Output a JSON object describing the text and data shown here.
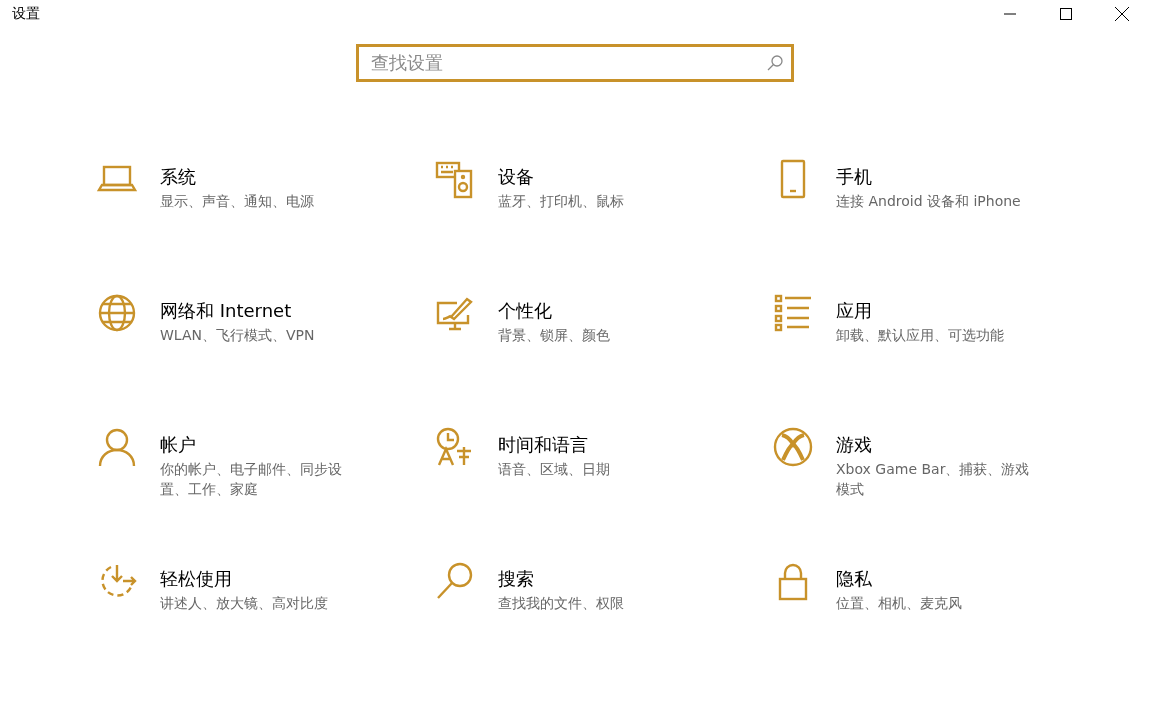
{
  "window": {
    "title": "设置"
  },
  "search": {
    "placeholder": "查找设置"
  },
  "categories": [
    {
      "kind": "system",
      "title": "系统",
      "description": "显示、声音、通知、电源"
    },
    {
      "kind": "devices",
      "title": "设备",
      "description": "蓝牙、打印机、鼠标"
    },
    {
      "kind": "phone",
      "title": "手机",
      "description": "连接 Android 设备和 iPhone"
    },
    {
      "kind": "network",
      "title": "网络和 Internet",
      "description": "WLAN、飞行模式、VPN"
    },
    {
      "kind": "personalization",
      "title": "个性化",
      "description": "背景、锁屏、颜色"
    },
    {
      "kind": "apps",
      "title": "应用",
      "description": "卸载、默认应用、可选功能"
    },
    {
      "kind": "accounts",
      "title": "帐户",
      "description": "你的帐户、电子邮件、同步设置、工作、家庭"
    },
    {
      "kind": "time",
      "title": "时间和语言",
      "description": "语音、区域、日期"
    },
    {
      "kind": "gaming",
      "title": "游戏",
      "description": "Xbox Game Bar、捕获、游戏模式"
    },
    {
      "kind": "ease",
      "title": "轻松使用",
      "description": "讲述人、放大镜、高对比度"
    },
    {
      "kind": "search",
      "title": "搜索",
      "description": "查找我的文件、权限"
    },
    {
      "kind": "privacy",
      "title": "隐私",
      "description": "位置、相机、麦克风"
    }
  ]
}
